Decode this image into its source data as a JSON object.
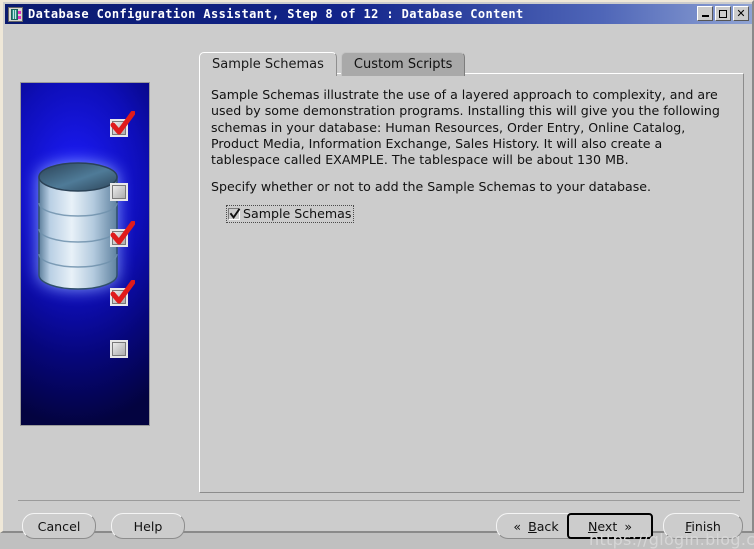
{
  "window": {
    "title": "Database Configuration Assistant, Step 8 of 12 : Database Content",
    "icon": "database-server-icon",
    "controls": {
      "minimize": "_",
      "maximize": "□",
      "close": "×"
    }
  },
  "sidebar": {
    "image_alt": "database-illustration",
    "markers": [
      {
        "state": "checked"
      },
      {
        "state": "unchecked"
      },
      {
        "state": "checked"
      },
      {
        "state": "checked"
      },
      {
        "state": "unchecked"
      }
    ],
    "colors": {
      "background_start": "#1d1dff",
      "background_end": "#030340",
      "check_red": "#e01b1b",
      "cylinder": "#b9cfe4"
    }
  },
  "tabs": [
    {
      "label": "Sample Schemas",
      "active": true
    },
    {
      "label": "Custom Scripts",
      "active": false
    }
  ],
  "main": {
    "paragraph1": "Sample Schemas illustrate the use of a layered approach to complexity, and are used by some demonstration programs. Installing this will give you the following schemas in your database: Human Resources, Order Entry, Online Catalog, Product Media, Information Exchange, Sales History. It will also create a tablespace called EXAMPLE. The tablespace will be about 130 MB.",
    "paragraph2": "Specify whether or not to add the Sample Schemas to your database.",
    "checkbox": {
      "label": "Sample Schemas",
      "checked": true,
      "focused": true
    }
  },
  "buttons": {
    "cancel": "Cancel",
    "help": "Help",
    "back": "Back",
    "back_mnemonic": "B",
    "next": "Next",
    "next_mnemonic": "N",
    "finish": "Finish",
    "finish_mnemonic": "F",
    "back_icon": "chevron-double-left-icon",
    "next_icon": "chevron-double-right-icon",
    "focused": "Next"
  },
  "watermark": {
    "text": "https://glogin.blog.csdn.net"
  }
}
